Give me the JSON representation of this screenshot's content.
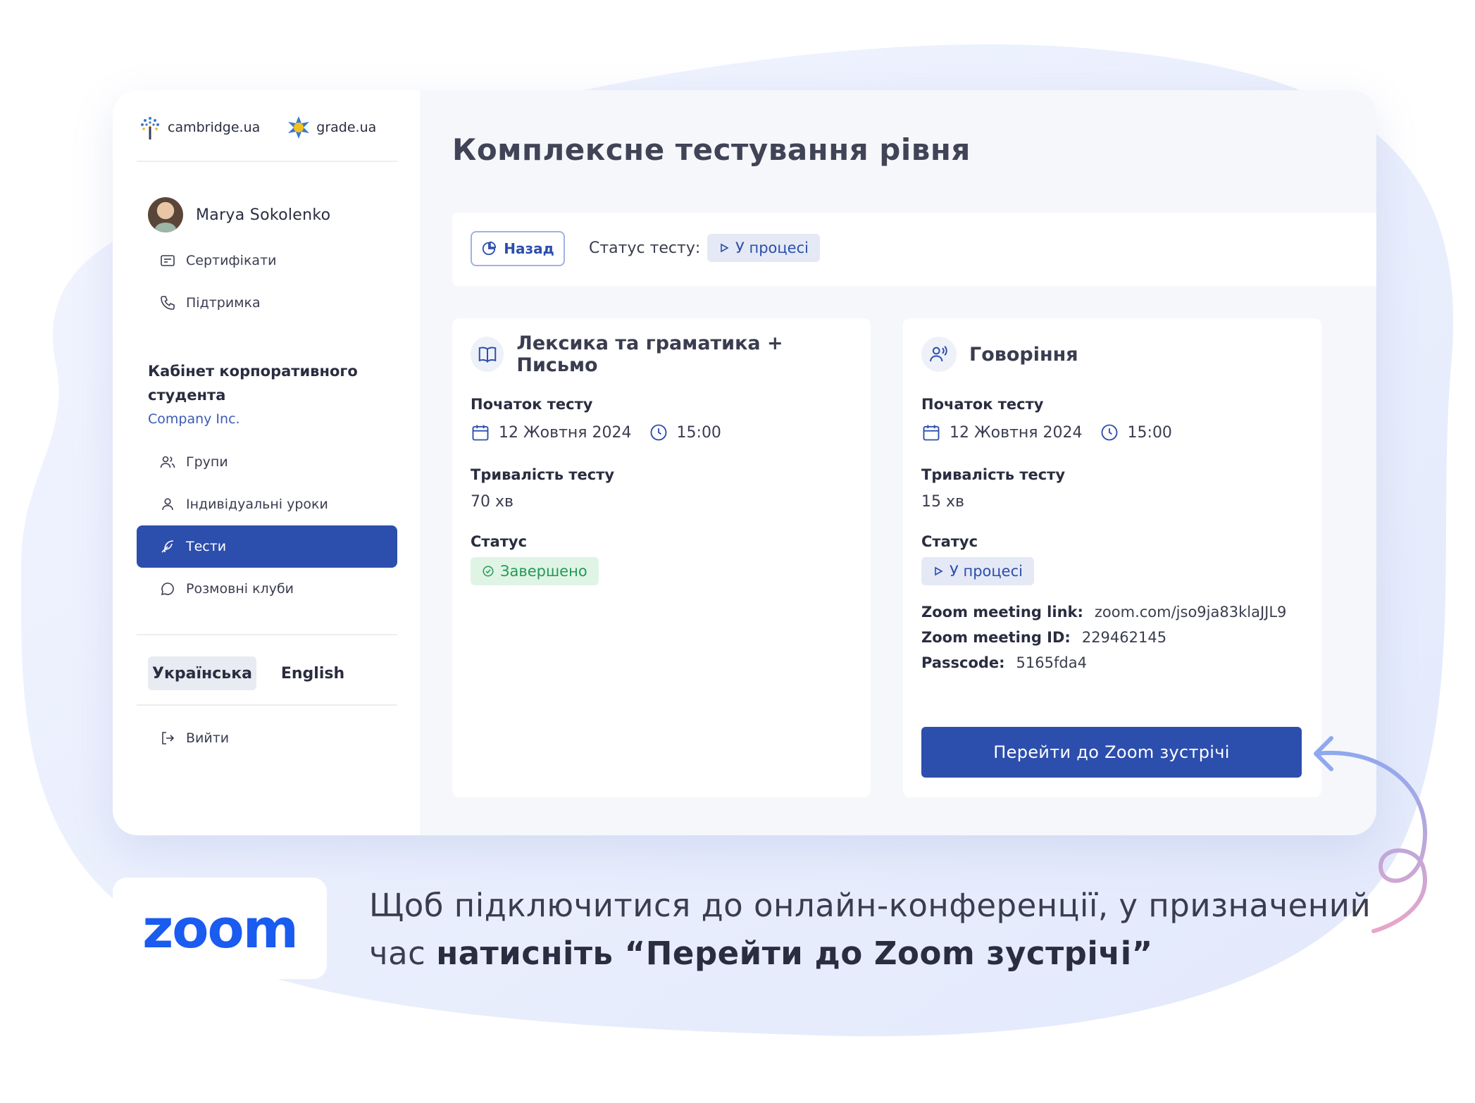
{
  "logos": {
    "cambridge": "cambridge.ua",
    "grade": "grade.ua"
  },
  "user": {
    "name": "Marya Sokolenko"
  },
  "sidebar": {
    "top_items": [
      {
        "label": "Сертифікати",
        "icon": "certificate-icon"
      },
      {
        "label": "Підтримка",
        "icon": "phone-icon"
      }
    ],
    "section_title": "Кабінет корпоративного студента",
    "company": "Company Inc.",
    "items": [
      {
        "label": "Групи",
        "icon": "users-icon"
      },
      {
        "label": "Індивідуальні уроки",
        "icon": "user-icon"
      },
      {
        "label": "Тести",
        "icon": "feather-icon",
        "active": true
      },
      {
        "label": "Розмовні клуби",
        "icon": "chat-icon"
      }
    ],
    "languages": [
      {
        "label": "Українська",
        "selected": true
      },
      {
        "label": "English",
        "selected": false
      }
    ],
    "logout": "Вийти"
  },
  "main": {
    "title": "Комплексне тестування рівня",
    "back": "Назад",
    "status_label": "Статус тесту:",
    "status_value": "У процесі"
  },
  "cards": [
    {
      "title": "Лексика та граматика + Письмо",
      "start_label": "Початок тесту",
      "date": "12 Жовтня 2024",
      "time": "15:00",
      "duration_label": "Тривалість тесту",
      "duration": "70 хв",
      "status_label": "Статус",
      "status": "Завершено"
    },
    {
      "title": "Говоріння",
      "start_label": "Початок тесту",
      "date": "12 Жовтня 2024",
      "time": "15:00",
      "duration_label": "Тривалість тесту",
      "duration": "15 хв",
      "status_label": "Статус",
      "status": "У процесі",
      "zoom_link_label": "Zoom meeting link:",
      "zoom_link": "zoom.com/jso9ja83klaJJL9",
      "zoom_id_label": "Zoom meeting ID:",
      "zoom_id": "229462145",
      "passcode_label": "Passcode:",
      "passcode": "5165fda4",
      "button": "Перейти до Zoom зустрічі"
    }
  ],
  "promo": {
    "zoom_logo": "zoom",
    "caption_regular": "Щоб підключитися до онлайн-конференції, у призначений час ",
    "caption_bold": "натисніть “Перейти до Zoom зустрічі”"
  },
  "colors": {
    "accent": "#2c4ead",
    "done": "#219a55",
    "zoom": "#1a5bf0"
  }
}
